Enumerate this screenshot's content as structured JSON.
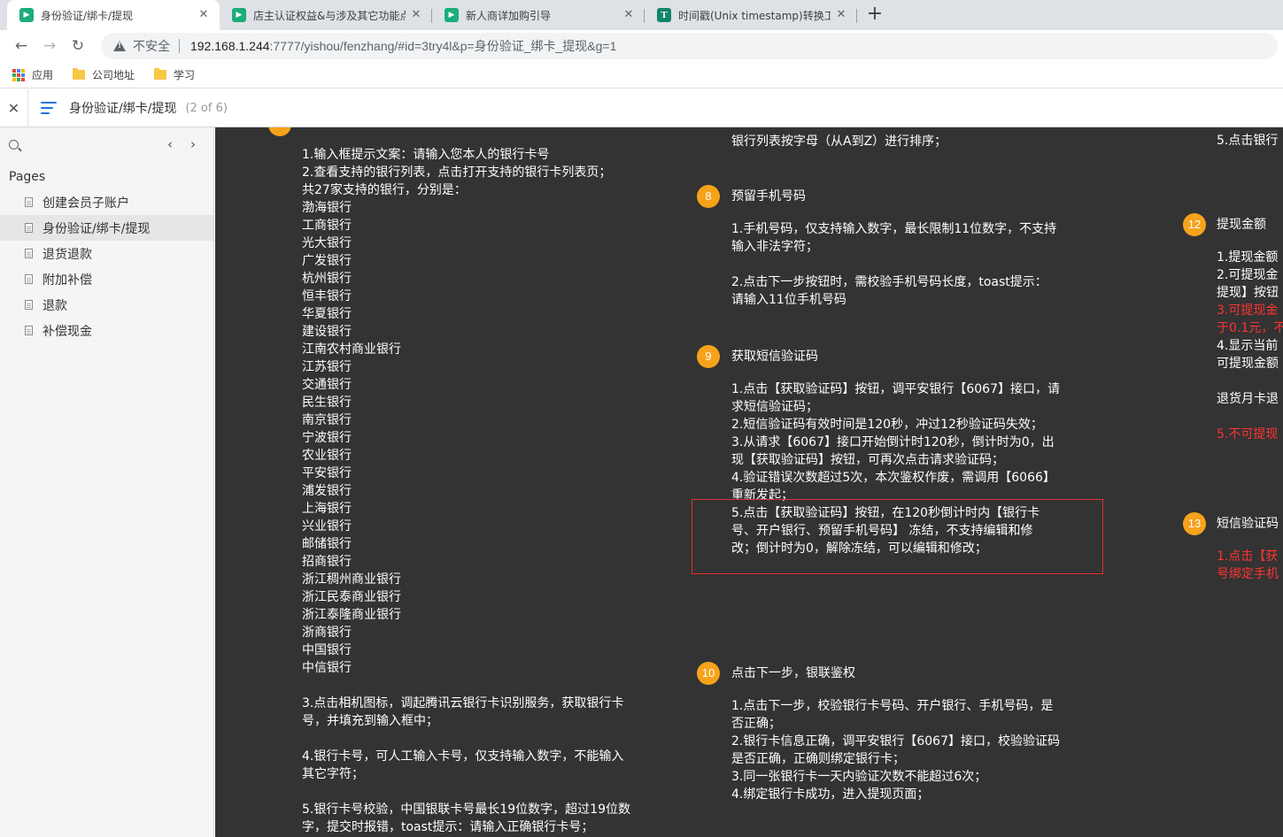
{
  "browser": {
    "tabs": [
      {
        "title": "身份验证/绑卡/提现",
        "active": true,
        "icon": "axure-icon"
      },
      {
        "title": "店主认证权益&与涉及其它功能点",
        "active": false,
        "icon": "axure-icon"
      },
      {
        "title": "新人商详加购引导",
        "active": false,
        "icon": "axure-icon"
      },
      {
        "title": "时间戳(Unix timestamp)转换工具",
        "active": false,
        "icon": "t-icon"
      }
    ],
    "new_tab": "+",
    "insecure_label": "不安全",
    "url_host": "192.168.1.244",
    "url_rest": ":7777/yishou/fenzhang/#id=3try4l&p=身份验证_绑卡_提现&g=1",
    "bookmarks": [
      "应用",
      "公司地址",
      "学习"
    ]
  },
  "axure": {
    "page_title": "身份验证/绑卡/提现",
    "page_count": "(2 of 6)",
    "pages_heading": "Pages",
    "pages": [
      "创建会员子账户",
      "身份验证/绑卡/提现",
      "退货退款",
      "附加补偿",
      "退款",
      "补偿现金"
    ]
  },
  "content": {
    "col1": [
      "1.输入框提示文案：请输入您本人的银行卡号",
      "2.查看支持的银行列表，点击打开支持的银行卡列表页；",
      "共27家支持的银行，分别是：",
      "渤海银行",
      "工商银行",
      "光大银行",
      "广发银行",
      "杭州银行",
      "恒丰银行",
      "华夏银行",
      "建设银行",
      "江南农村商业银行",
      "江苏银行",
      "交通银行",
      "民生银行",
      "南京银行",
      "宁波银行",
      "农业银行",
      "平安银行",
      "浦发银行",
      "上海银行",
      "兴业银行",
      "邮储银行",
      "招商银行",
      "浙江稠州商业银行",
      "浙江民泰商业银行",
      "浙江泰隆商业银行",
      "浙商银行",
      "中国银行",
      "中信银行",
      "",
      "3.点击相机图标，调起腾讯云银行卡识别服务，获取银行卡",
      "号，并填充到输入框中；",
      "",
      "4.银行卡号，可人工输入卡号，仅支持输入数字，不能输入",
      "其它字符；",
      "",
      "5.银行卡号校验，中国银联卡号最长19位数字，超过19位数",
      "字，提交时报错，toast提示：请输入正确银行卡号；"
    ],
    "col2_top": [
      "银行列表按字母（从A到Z）进行排序；"
    ],
    "sec8": {
      "num": "8",
      "title": "预留手机号码",
      "lines": [
        "1.手机号码，仅支持输入数字，最长限制11位数字，不支持",
        "输入非法字符；",
        "",
        "2.点击下一步按钮时，需校验手机号码长度，toast提示：",
        "请输入11位手机号码"
      ]
    },
    "sec9": {
      "num": "9",
      "title": "获取短信验证码",
      "lines": [
        "1.点击【获取验证码】按钮，调平安银行【6067】接口，请",
        "求短信验证码；",
        "2.短信验证码有效时间是120秒，冲过12秒验证码失效；",
        "3.从请求【6067】接口开始倒计时120秒，倒计时为0，出",
        "现【获取验证码】按钮，可再次点击请求验证码；",
        "4.验证错误次数超过5次，本次鉴权作废，需调用【6066】",
        "重新发起；",
        "5.点击【获取验证码】按钮，在120秒倒计时内【银行卡",
        "号、开户银行、预留手机号码】 冻结，不支持编辑和修",
        "改；倒计时为0，解除冻结，可以编辑和修改；"
      ]
    },
    "sec10": {
      "num": "10",
      "title": "点击下一步，银联鉴权",
      "lines": [
        "1.点击下一步，校验银行卡号码、开户银行、手机号码，是",
        "否正确；",
        "2.银行卡信息正确，调平安银行【6067】接口，校验验证码",
        "是否正确，正确则绑定银行卡；",
        "3.同一张银行卡一天内验证次数不能超过6次；",
        "4.绑定银行卡成功，进入提现页面；"
      ]
    },
    "col3_top": [
      "5.点击银行"
    ],
    "sec12": {
      "num": "12",
      "title": "提现金额",
      "lines": [
        {
          "text": "1.提现金额",
          "red": false
        },
        {
          "text": "2.可提现金",
          "red": false
        },
        {
          "text": "提现】按钮",
          "red": false
        },
        {
          "text": "3.可提现金",
          "red": true
        },
        {
          "text": "于0.1元，不",
          "red": true
        },
        {
          "text": "4.显示当前",
          "red": false
        },
        {
          "text": "可提现金额",
          "red": false
        },
        {
          "text": "",
          "red": false
        },
        {
          "text": "退货月卡退",
          "red": false
        },
        {
          "text": "",
          "red": false
        },
        {
          "text": "5.不可提现",
          "red": true
        }
      ]
    },
    "sec13": {
      "num": "13",
      "title": "短信验证码",
      "lines": [
        {
          "text": "1.点击【获",
          "red": true
        },
        {
          "text": "号绑定手机",
          "red": true
        }
      ]
    }
  }
}
